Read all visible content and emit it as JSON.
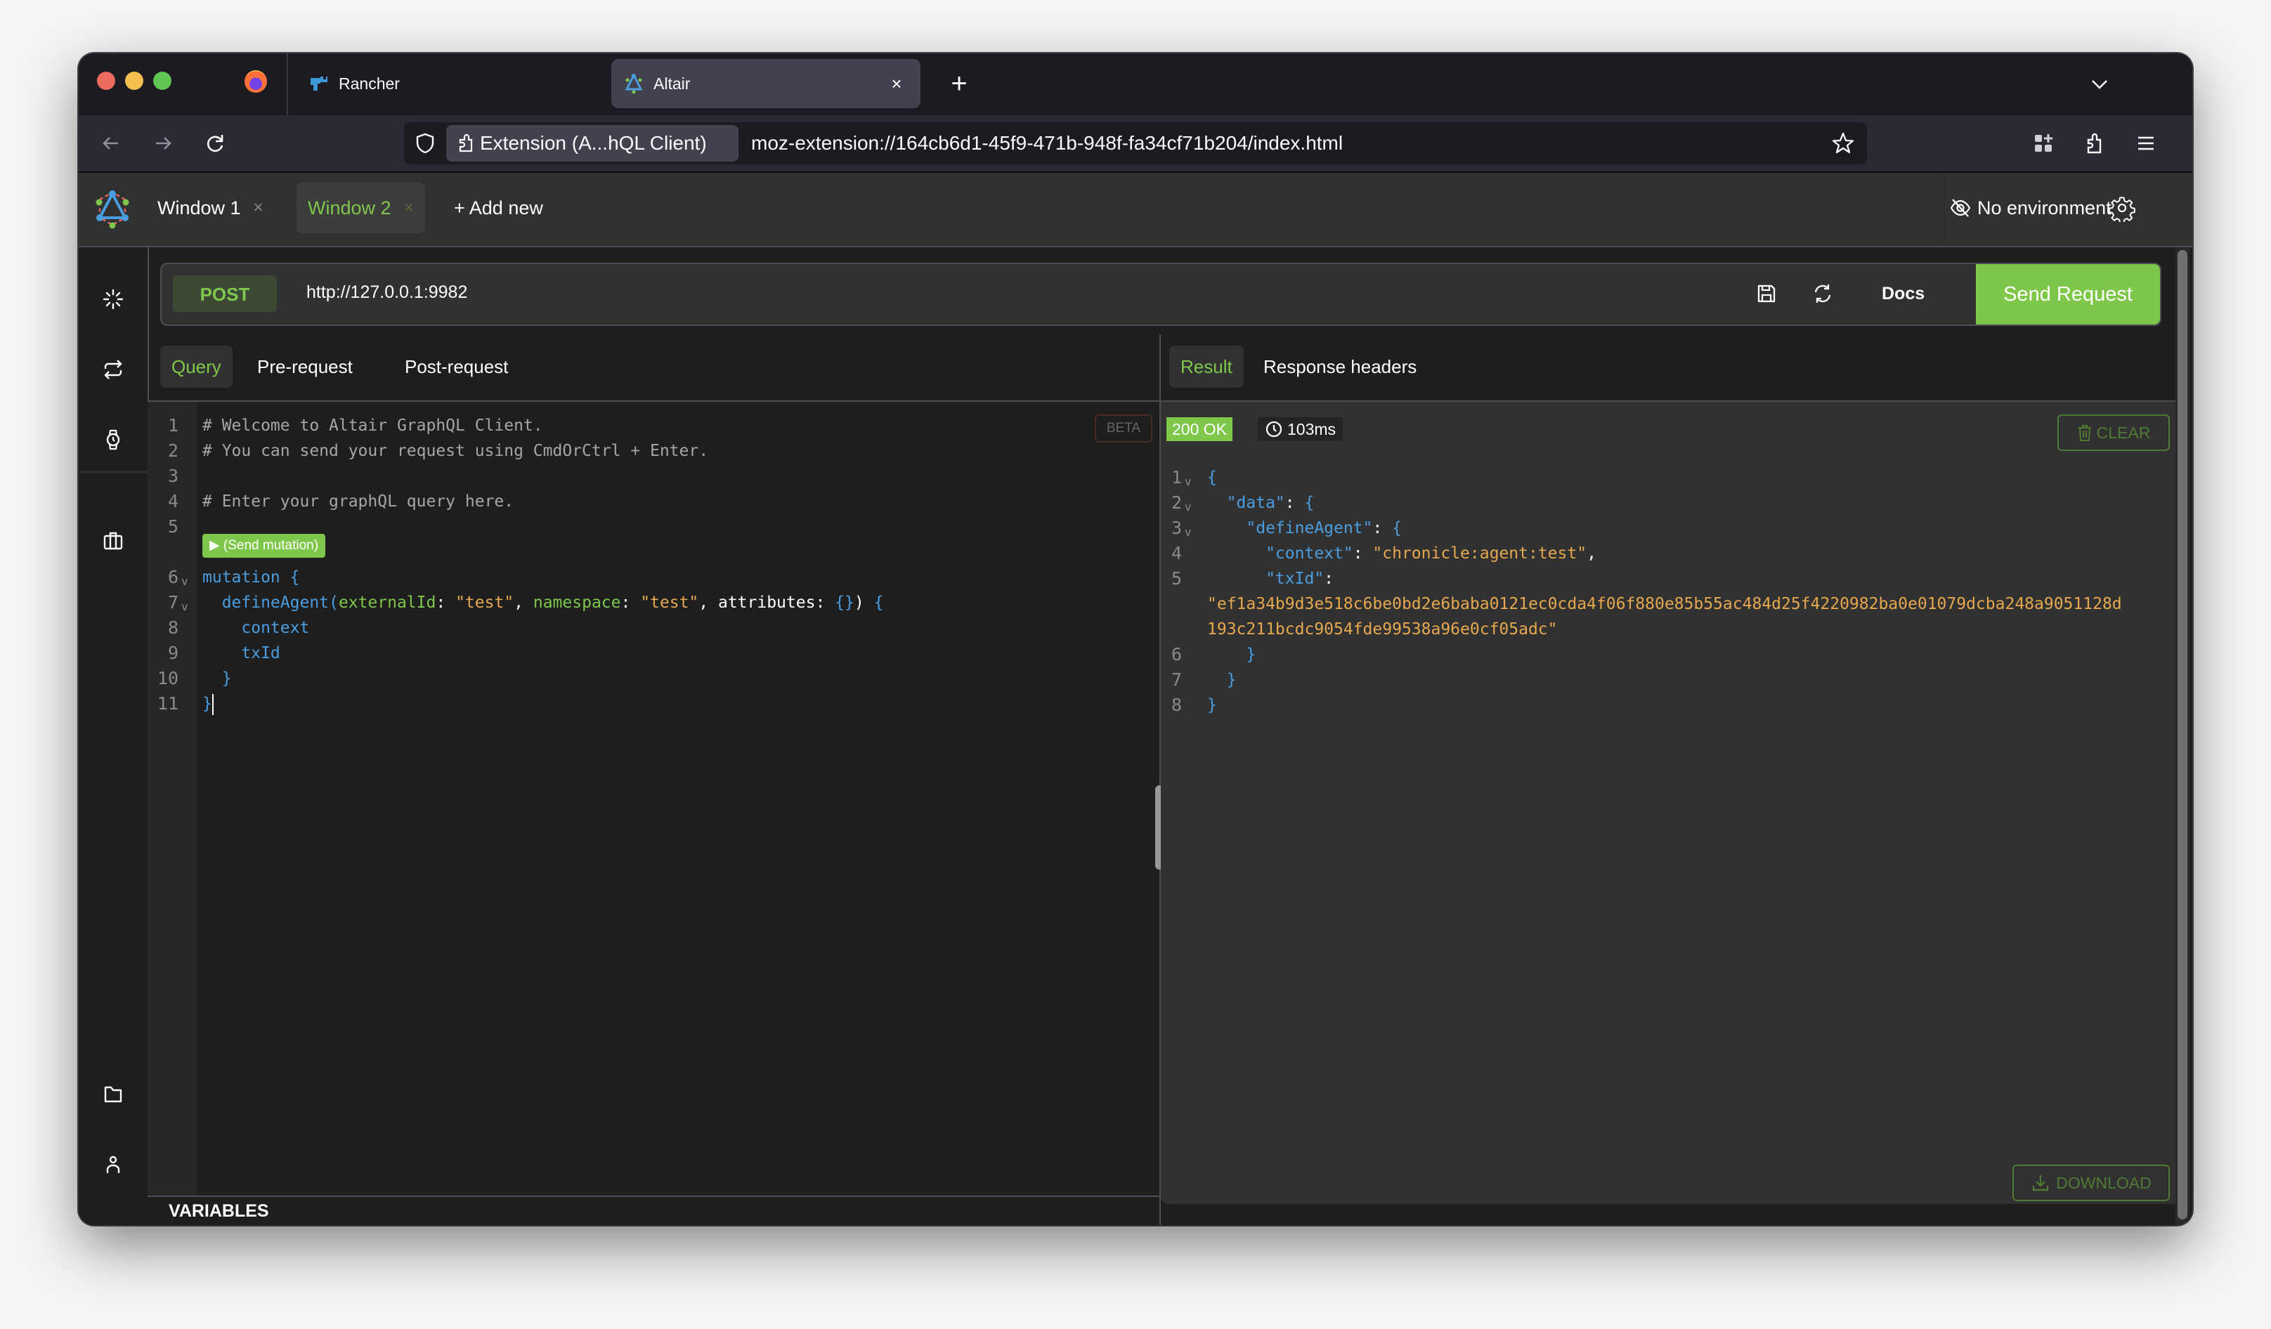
{
  "browser": {
    "tabs": [
      {
        "title": "Rancher",
        "favicon": "rancher-icon",
        "active": false
      },
      {
        "title": "Altair",
        "favicon": "altair-icon",
        "active": true
      }
    ],
    "new_tab_label": "+",
    "identity_chip": "Extension (A...hQL Client)",
    "url": "moz-extension://164cb6d1-45f9-471b-948f-fa34cf71b204/index.html",
    "icons": [
      "back-icon",
      "forward-icon",
      "reload-icon",
      "shield-icon",
      "bookmark-star-icon",
      "containers-icon",
      "extensions-icon",
      "menu-icon",
      "tab-list-chevron-icon"
    ]
  },
  "app": {
    "window_tabs": [
      {
        "label": "Window 1",
        "close": "×",
        "active": false
      },
      {
        "label": "Window 2",
        "close": "×",
        "active": true
      }
    ],
    "add_new_label": "+ Add new",
    "environment_label": "No environment",
    "sidebar_icons": [
      "sparkle-icon",
      "repeat-icon",
      "watch-icon",
      "briefcase-icon",
      "folder-icon",
      "user-icon"
    ],
    "request": {
      "method": "POST",
      "url": "http://127.0.0.1:9982",
      "docs_label": "Docs",
      "send_label": "Send Request"
    },
    "query_tabs": [
      "Query",
      "Pre-request",
      "Post-request"
    ],
    "beta_label": "BETA",
    "send_mutation_label": "▶ (Send mutation)",
    "query_lines": [
      {
        "n": "1",
        "fold": "",
        "tokens": [
          {
            "t": "# Welcome to Altair GraphQL Client.",
            "c": "c-comment"
          }
        ]
      },
      {
        "n": "2",
        "fold": "",
        "tokens": [
          {
            "t": "# You can send your request using CmdOrCtrl + Enter.",
            "c": "c-comment"
          }
        ]
      },
      {
        "n": "3",
        "fold": "",
        "tokens": []
      },
      {
        "n": "4",
        "fold": "",
        "tokens": [
          {
            "t": "# Enter your graphQL query here.",
            "c": "c-comment"
          }
        ]
      },
      {
        "n": "5",
        "fold": "",
        "tokens": []
      },
      {
        "n": "6",
        "fold": "v",
        "tokens": [
          {
            "t": "mutation ",
            "c": "c-kw"
          },
          {
            "t": "{",
            "c": "c-punc"
          }
        ]
      },
      {
        "n": "7",
        "fold": "v",
        "tokens": [
          {
            "t": "  defineAgent",
            "c": "c-field"
          },
          {
            "t": "(",
            "c": "c-punc"
          },
          {
            "t": "externalId",
            "c": "c-arg"
          },
          {
            "t": ": ",
            "c": "c-plain"
          },
          {
            "t": "\"test\"",
            "c": "c-str"
          },
          {
            "t": ", ",
            "c": "c-plain"
          },
          {
            "t": "namespace",
            "c": "c-arg"
          },
          {
            "t": ": ",
            "c": "c-plain"
          },
          {
            "t": "\"test\"",
            "c": "c-str"
          },
          {
            "t": ", attributes: ",
            "c": "c-plain"
          },
          {
            "t": "{}",
            "c": "c-punc"
          },
          {
            "t": ") ",
            "c": "c-plain"
          },
          {
            "t": "{",
            "c": "c-punc"
          }
        ]
      },
      {
        "n": "8",
        "fold": "",
        "tokens": [
          {
            "t": "    context",
            "c": "c-field"
          }
        ]
      },
      {
        "n": "9",
        "fold": "",
        "tokens": [
          {
            "t": "    txId",
            "c": "c-field"
          }
        ]
      },
      {
        "n": "10",
        "fold": "",
        "tokens": [
          {
            "t": "  }",
            "c": "c-punc"
          }
        ]
      },
      {
        "n": "11",
        "fold": "",
        "tokens": [
          {
            "t": "}",
            "c": "c-punc"
          }
        ]
      }
    ],
    "variables_label": "VARIABLES",
    "result_tabs": [
      "Result",
      "Response headers"
    ],
    "status_badge": "200 OK",
    "response_time": "103ms",
    "clear_label": "CLEAR",
    "download_label": "DOWNLOAD",
    "result_lines": [
      {
        "n": "1",
        "fold": "v",
        "tokens": [
          {
            "t": "{",
            "c": "c-punc"
          }
        ]
      },
      {
        "n": "2",
        "fold": "v",
        "tokens": [
          {
            "t": "  \"data\"",
            "c": "c-field"
          },
          {
            "t": ": ",
            "c": "c-plain"
          },
          {
            "t": "{",
            "c": "c-punc"
          }
        ]
      },
      {
        "n": "3",
        "fold": "v",
        "tokens": [
          {
            "t": "    \"defineAgent\"",
            "c": "c-field"
          },
          {
            "t": ": ",
            "c": "c-plain"
          },
          {
            "t": "{",
            "c": "c-punc"
          }
        ]
      },
      {
        "n": "4",
        "fold": "",
        "tokens": [
          {
            "t": "      \"context\"",
            "c": "c-field"
          },
          {
            "t": ": ",
            "c": "c-plain"
          },
          {
            "t": "\"chronicle:agent:test\"",
            "c": "c-str"
          },
          {
            "t": ",",
            "c": "c-plain"
          }
        ]
      },
      {
        "n": "5",
        "fold": "",
        "tokens": [
          {
            "t": "      \"txId\"",
            "c": "c-field"
          },
          {
            "t": ":",
            "c": "c-plain"
          }
        ]
      },
      {
        "n": "",
        "fold": "",
        "tokens": [
          {
            "t": "\"ef1a34b9d3e518c6be0bd2e6baba0121ec0cda4f06f880e85b55ac484d25f4220982ba0e01079dcba248a9051128d",
            "c": "c-str"
          }
        ]
      },
      {
        "n": "",
        "fold": "",
        "tokens": [
          {
            "t": "193c211bcdc9054fde99538a96e0cf05adc\"",
            "c": "c-str"
          }
        ]
      },
      {
        "n": "6",
        "fold": "",
        "tokens": [
          {
            "t": "    }",
            "c": "c-punc"
          }
        ]
      },
      {
        "n": "7",
        "fold": "",
        "tokens": [
          {
            "t": "  }",
            "c": "c-punc"
          }
        ]
      },
      {
        "n": "8",
        "fold": "",
        "tokens": [
          {
            "t": "}",
            "c": "c-punc"
          }
        ]
      }
    ],
    "colors": {
      "accent_green": "#7ec74b",
      "string_orange": "#e5a84f",
      "keyword_blue": "#4a9ee0"
    }
  }
}
